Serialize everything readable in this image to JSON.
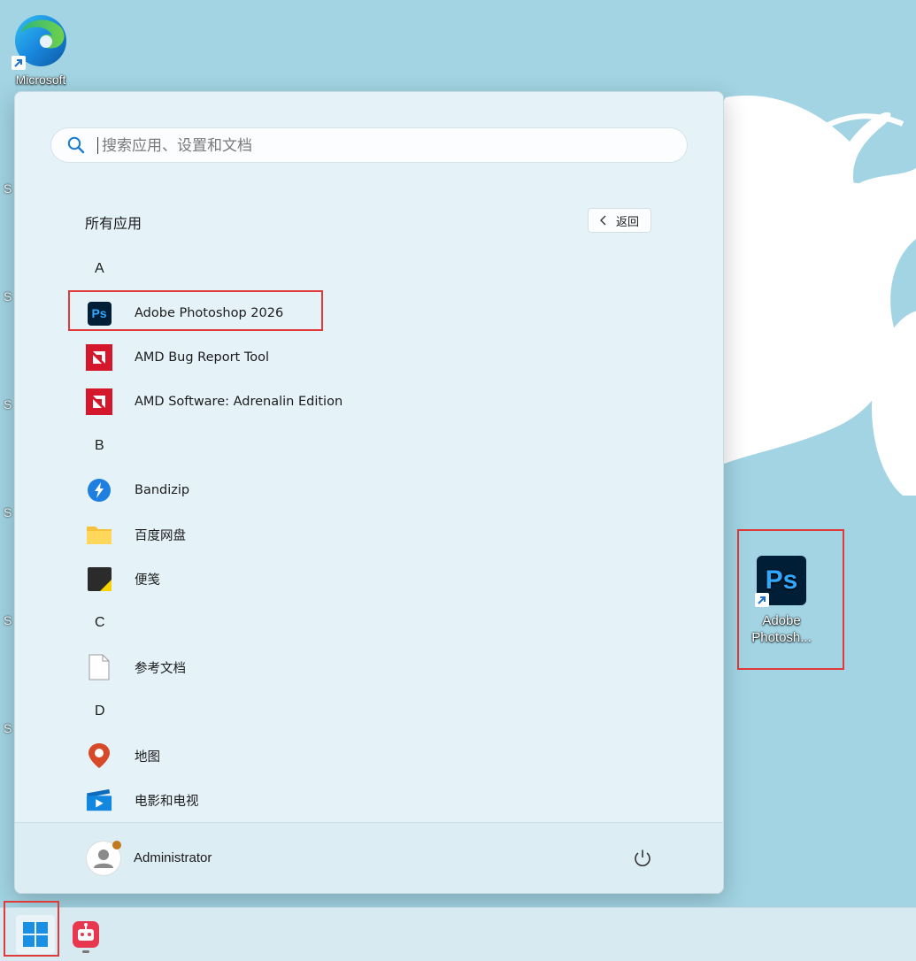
{
  "desktop": {
    "edge_icon_label": "Microsoft",
    "ps_shortcut_label_line1": "Adobe",
    "ps_shortcut_label_line2": "Photosh...",
    "ps_glyph": "Ps",
    "edge_letter": "S"
  },
  "start_menu": {
    "search_placeholder": "搜索应用、设置和文档",
    "section_title": "所有应用",
    "back_button_label": "返回",
    "groups": [
      {
        "letter": "A",
        "apps": [
          {
            "label": "Adobe Photoshop 2026",
            "icon": "photoshop-icon"
          },
          {
            "label": "AMD Bug Report Tool",
            "icon": "amd-icon"
          },
          {
            "label": "AMD Software: Adrenalin Edition",
            "icon": "amd-icon"
          }
        ]
      },
      {
        "letter": "B",
        "apps": [
          {
            "label": "Bandizip",
            "icon": "bandizip-icon"
          },
          {
            "label": "百度网盘",
            "icon": "folder-icon"
          },
          {
            "label": "便笺",
            "icon": "sticky-notes-icon"
          }
        ]
      },
      {
        "letter": "C",
        "apps": [
          {
            "label": "参考文档",
            "icon": "document-icon"
          }
        ]
      },
      {
        "letter": "D",
        "apps": [
          {
            "label": "地图",
            "icon": "maps-icon"
          },
          {
            "label": "电影和电视",
            "icon": "movies-tv-icon"
          }
        ]
      }
    ],
    "user_name": "Administrator"
  },
  "colors": {
    "annotation_red": "#e03a3a",
    "desktop_bg": "#a2d4e3",
    "menu_bg": "#e5f3f9",
    "ps_dark": "#001e36",
    "ps_blue": "#31a8ff"
  }
}
